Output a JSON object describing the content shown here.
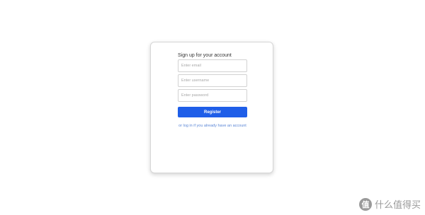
{
  "signup": {
    "title": "Sign up for your account",
    "email_placeholder": "Enter email",
    "username_placeholder": "Enter username",
    "password_placeholder": "Enter password",
    "register_label": "Register",
    "login_link_text": "or log in if you already have an account"
  },
  "watermark": {
    "logo_glyph": "值",
    "text": "什么值得买"
  },
  "colors": {
    "accent": "#1f5ee8",
    "link": "#5b86d6",
    "card_border": "#d6d6d6"
  }
}
